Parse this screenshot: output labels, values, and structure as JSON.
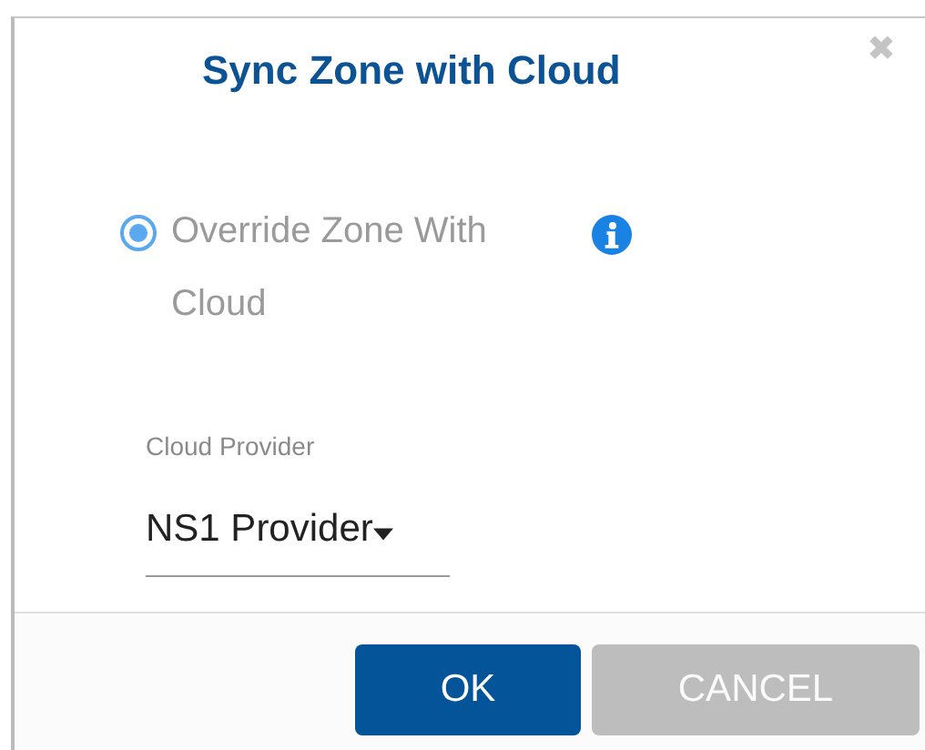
{
  "dialog": {
    "title": "Sync Zone with Cloud",
    "close": "✖"
  },
  "option": {
    "label": "Override Zone With Cloud",
    "selected": true
  },
  "provider": {
    "label": "Cloud Provider",
    "value": "NS1 Provider"
  },
  "buttons": [
    {
      "label": "OK",
      "kind": "primary"
    },
    {
      "label": "CANCEL",
      "kind": "secondary"
    }
  ]
}
